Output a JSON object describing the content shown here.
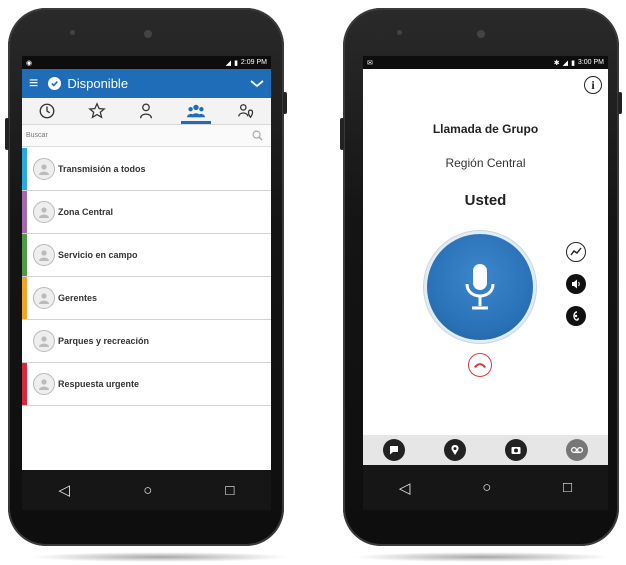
{
  "left_phone": {
    "status_time": "2:09 PM",
    "app_title": "Disponible",
    "search_placeholder": "Buscar",
    "tabs": [
      {
        "icon": "history-icon"
      },
      {
        "icon": "star-icon"
      },
      {
        "icon": "person-icon"
      },
      {
        "icon": "group-icon",
        "active": true
      },
      {
        "icon": "location-group-icon"
      }
    ],
    "groups": [
      {
        "name": "Transmisión a todos",
        "color": "#29a9df"
      },
      {
        "name": "Zona Central",
        "color": "#a26ab0"
      },
      {
        "name": "Servicio en campo",
        "color": "#4f9a45"
      },
      {
        "name": "Gerentes",
        "color": "#f0a329"
      },
      {
        "name": "Parques y recreación",
        "color": "#ffffff"
      },
      {
        "name": "Respuesta urgente",
        "color": "#d8283a"
      }
    ],
    "accent": "#1f6db8"
  },
  "right_phone": {
    "status_time": "3:00 PM",
    "title": "Llamada de Grupo",
    "subtitle": "Región Central",
    "speaker": "Usted",
    "ptt_color": "#2b73b9",
    "end_call_color": "#d63a3a"
  }
}
